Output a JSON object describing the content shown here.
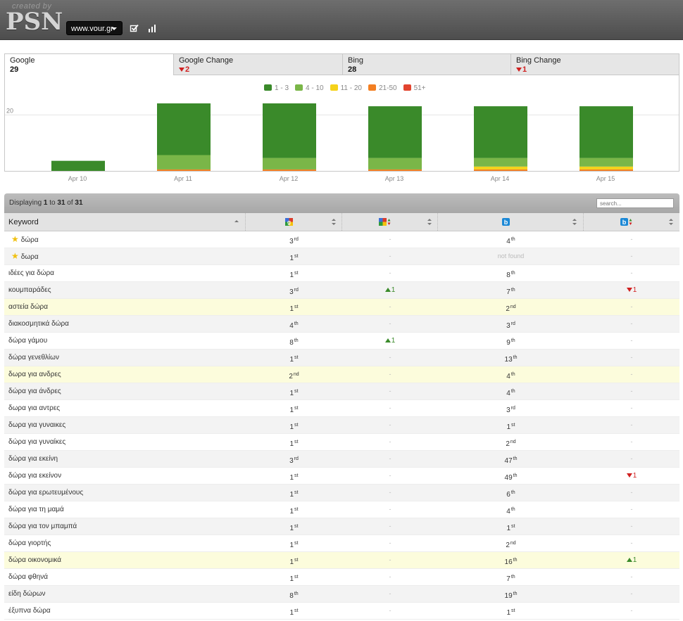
{
  "header": {
    "created_by": "created by",
    "logo": "PSN",
    "site_select": "www.vour.gr"
  },
  "tabs": [
    {
      "label": "Google",
      "value": "29",
      "direction": "none"
    },
    {
      "label": "Google Change",
      "value": "2",
      "direction": "down"
    },
    {
      "label": "Bing",
      "value": "28",
      "direction": "none"
    },
    {
      "label": "Bing Change",
      "value": "1",
      "direction": "down"
    }
  ],
  "colors": {
    "r1_3": "#3a8a2a",
    "r4_10": "#7ab648",
    "r11_20": "#f5d21a",
    "r21_50": "#f37f22",
    "r51p": "#e2442f",
    "down": "#d02020",
    "up": "#3a8a2a"
  },
  "chart_data": {
    "type": "bar",
    "stacked": true,
    "categories": [
      "Apr 10",
      "Apr 11",
      "Apr 12",
      "Apr 13",
      "Apr 14",
      "Apr 15"
    ],
    "series": [
      {
        "name": "1 - 3",
        "color": "#3a8a2a",
        "values": [
          4,
          18,
          19,
          18,
          18,
          18
        ]
      },
      {
        "name": "4 - 10",
        "color": "#7ab648",
        "values": [
          0,
          5,
          4,
          4,
          3,
          3
        ]
      },
      {
        "name": "11 - 20",
        "color": "#f5d21a",
        "values": [
          0,
          0,
          0,
          0,
          1,
          1
        ]
      },
      {
        "name": "21-50",
        "color": "#f37f22",
        "values": [
          0,
          1,
          1,
          1,
          1,
          1
        ]
      },
      {
        "name": "51+",
        "color": "#e2442f",
        "values": [
          0,
          0,
          0,
          0,
          0,
          0
        ]
      }
    ],
    "yticks": [
      20
    ],
    "ylim": [
      0,
      30
    ],
    "legend_position": "top-center",
    "grid": true
  },
  "table": {
    "display_prefix": "Displaying",
    "display_from": "1",
    "display_to_word": "to",
    "display_to": "31",
    "display_of_word": "of",
    "display_total": "31",
    "search_placeholder": "search...",
    "columns": {
      "keyword": "Keyword",
      "google": "google-icon",
      "google_change": "google-change-icon",
      "bing": "bing-icon",
      "bing_change": "bing-change-icon"
    },
    "rows": [
      {
        "keyword": "δώρα",
        "star": true,
        "highlight": false,
        "g": "3",
        "gs": "rd",
        "gc": "-",
        "gcd": "",
        "b": "4",
        "bs": "th",
        "bc": "-",
        "bcd": ""
      },
      {
        "keyword": "δωρα",
        "star": true,
        "highlight": false,
        "g": "1",
        "gs": "st",
        "gc": "-",
        "gcd": "",
        "b": "not found",
        "bs": "",
        "bc": "-",
        "bcd": ""
      },
      {
        "keyword": "ιδέες για δώρα",
        "star": false,
        "highlight": false,
        "g": "1",
        "gs": "st",
        "gc": "-",
        "gcd": "",
        "b": "8",
        "bs": "th",
        "bc": "-",
        "bcd": ""
      },
      {
        "keyword": "κουμπαράδες",
        "star": false,
        "highlight": false,
        "g": "3",
        "gs": "rd",
        "gc": "1",
        "gcd": "up",
        "b": "7",
        "bs": "th",
        "bc": "1",
        "bcd": "down"
      },
      {
        "keyword": "αστεία δώρα",
        "star": false,
        "highlight": true,
        "g": "1",
        "gs": "st",
        "gc": "-",
        "gcd": "",
        "b": "2",
        "bs": "nd",
        "bc": "-",
        "bcd": ""
      },
      {
        "keyword": "διακοσμητικά δώρα",
        "star": false,
        "highlight": false,
        "g": "4",
        "gs": "th",
        "gc": "-",
        "gcd": "",
        "b": "3",
        "bs": "rd",
        "bc": "-",
        "bcd": ""
      },
      {
        "keyword": "δώρα γάμου",
        "star": false,
        "highlight": false,
        "g": "8",
        "gs": "th",
        "gc": "1",
        "gcd": "up",
        "b": "9",
        "bs": "th",
        "bc": "-",
        "bcd": ""
      },
      {
        "keyword": "δώρα γενεθλίων",
        "star": false,
        "highlight": false,
        "g": "1",
        "gs": "st",
        "gc": "-",
        "gcd": "",
        "b": "13",
        "bs": "th",
        "bc": "-",
        "bcd": ""
      },
      {
        "keyword": "δωρα για ανδρες",
        "star": false,
        "highlight": true,
        "g": "2",
        "gs": "nd",
        "gc": "-",
        "gcd": "",
        "b": "4",
        "bs": "th",
        "bc": "-",
        "bcd": ""
      },
      {
        "keyword": "δώρα για άνδρες",
        "star": false,
        "highlight": false,
        "g": "1",
        "gs": "st",
        "gc": "-",
        "gcd": "",
        "b": "4",
        "bs": "th",
        "bc": "-",
        "bcd": ""
      },
      {
        "keyword": "δωρα για αντρες",
        "star": false,
        "highlight": false,
        "g": "1",
        "gs": "st",
        "gc": "-",
        "gcd": "",
        "b": "3",
        "bs": "rd",
        "bc": "-",
        "bcd": ""
      },
      {
        "keyword": "δωρα για γυναικες",
        "star": false,
        "highlight": false,
        "g": "1",
        "gs": "st",
        "gc": "-",
        "gcd": "",
        "b": "1",
        "bs": "st",
        "bc": "-",
        "bcd": ""
      },
      {
        "keyword": "δώρα για γυναίκες",
        "star": false,
        "highlight": false,
        "g": "1",
        "gs": "st",
        "gc": "-",
        "gcd": "",
        "b": "2",
        "bs": "nd",
        "bc": "-",
        "bcd": ""
      },
      {
        "keyword": "δώρα για εκείνη",
        "star": false,
        "highlight": false,
        "g": "3",
        "gs": "rd",
        "gc": "-",
        "gcd": "",
        "b": "47",
        "bs": "th",
        "bc": "-",
        "bcd": ""
      },
      {
        "keyword": "δώρα για εκείνον",
        "star": false,
        "highlight": false,
        "g": "1",
        "gs": "st",
        "gc": "-",
        "gcd": "",
        "b": "49",
        "bs": "th",
        "bc": "1",
        "bcd": "down"
      },
      {
        "keyword": "δώρα για ερωτευμένους",
        "star": false,
        "highlight": false,
        "g": "1",
        "gs": "st",
        "gc": "-",
        "gcd": "",
        "b": "6",
        "bs": "th",
        "bc": "-",
        "bcd": ""
      },
      {
        "keyword": "δώρα για τη μαμά",
        "star": false,
        "highlight": false,
        "g": "1",
        "gs": "st",
        "gc": "-",
        "gcd": "",
        "b": "4",
        "bs": "th",
        "bc": "-",
        "bcd": ""
      },
      {
        "keyword": "δώρα για τον μπαμπά",
        "star": false,
        "highlight": false,
        "g": "1",
        "gs": "st",
        "gc": "-",
        "gcd": "",
        "b": "1",
        "bs": "st",
        "bc": "-",
        "bcd": ""
      },
      {
        "keyword": "δώρα γιορτής",
        "star": false,
        "highlight": false,
        "g": "1",
        "gs": "st",
        "gc": "-",
        "gcd": "",
        "b": "2",
        "bs": "nd",
        "bc": "-",
        "bcd": ""
      },
      {
        "keyword": "δώρα οικονομικά",
        "star": false,
        "highlight": true,
        "g": "1",
        "gs": "st",
        "gc": "-",
        "gcd": "",
        "b": "16",
        "bs": "th",
        "bc": "1",
        "bcd": "up"
      },
      {
        "keyword": "δώρα φθηνά",
        "star": false,
        "highlight": false,
        "g": "1",
        "gs": "st",
        "gc": "-",
        "gcd": "",
        "b": "7",
        "bs": "th",
        "bc": "-",
        "bcd": ""
      },
      {
        "keyword": "είδη δώρων",
        "star": false,
        "highlight": false,
        "g": "8",
        "gs": "th",
        "gc": "-",
        "gcd": "",
        "b": "19",
        "bs": "th",
        "bc": "-",
        "bcd": ""
      },
      {
        "keyword": "έξυπνα δώρα",
        "star": false,
        "highlight": false,
        "g": "1",
        "gs": "st",
        "gc": "-",
        "gcd": "",
        "b": "1",
        "bs": "st",
        "bc": "-",
        "bcd": ""
      }
    ]
  }
}
